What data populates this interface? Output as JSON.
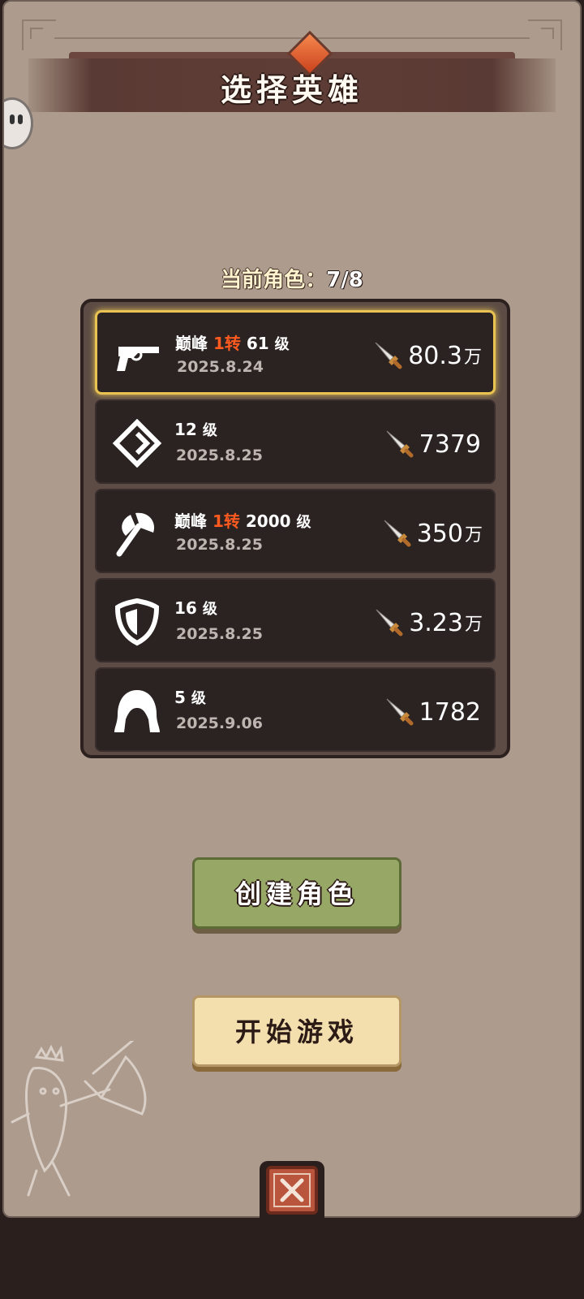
{
  "header": {
    "title": "选择英雄"
  },
  "roster": {
    "label": "当前角色：",
    "value": "7/8"
  },
  "characters": [
    {
      "icon": "revolver-icon",
      "peak": "巅峰",
      "rebirth": "1转",
      "level": "61",
      "level_unit": "级",
      "date": "2025.8.24",
      "power": "80.3",
      "power_unit": "万",
      "selected": true
    },
    {
      "icon": "rune-diamond-icon",
      "peak": "",
      "rebirth": "",
      "level": "12",
      "level_unit": "级",
      "date": "2025.8.25",
      "power": "7379",
      "power_unit": "",
      "selected": false
    },
    {
      "icon": "axe-icon",
      "peak": "巅峰",
      "rebirth": "1转",
      "level": "2000",
      "level_unit": "级",
      "date": "2025.8.25",
      "power": "350",
      "power_unit": "万",
      "selected": false
    },
    {
      "icon": "shield-icon",
      "peak": "",
      "rebirth": "",
      "level": "16",
      "level_unit": "级",
      "date": "2025.8.25",
      "power": "3.23",
      "power_unit": "万",
      "selected": false
    },
    {
      "icon": "hood-icon",
      "peak": "",
      "rebirth": "",
      "level": "5",
      "level_unit": "级",
      "date": "2025.9.06",
      "power": "1782",
      "power_unit": "",
      "selected": false
    }
  ],
  "buttons": {
    "create": "创建角色",
    "start": "开始游戏"
  },
  "colors": {
    "panel": "#ad9b8d",
    "row": "#2b2222",
    "selected_border": "#e9c351",
    "rebirth": "#ff5a1f",
    "create_button": "#97a866",
    "start_button": "#f2dfad"
  }
}
